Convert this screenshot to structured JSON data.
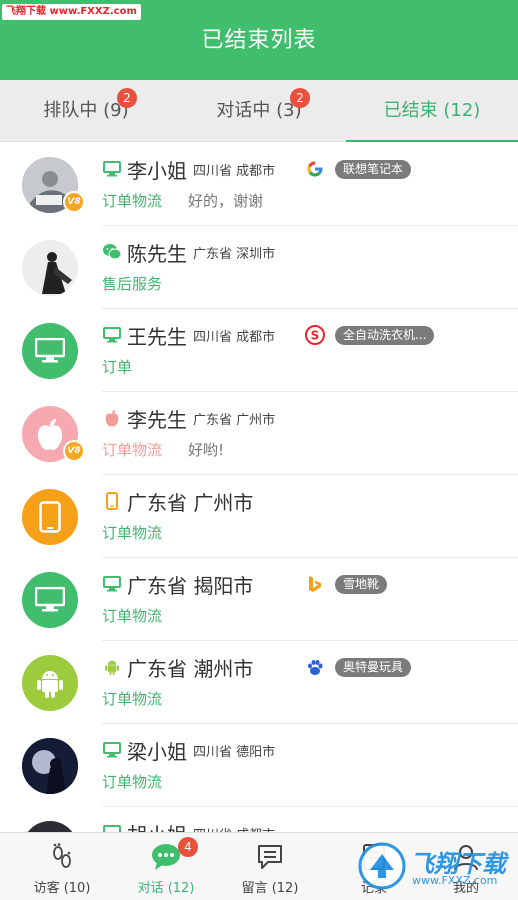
{
  "watermark_top": "飞翔下载 www.FXXZ.com",
  "header": {
    "title": "已结束列表"
  },
  "tabs": [
    {
      "label": "排队中 (9)",
      "badge": "2"
    },
    {
      "label": "对话中 (3)",
      "badge": "2"
    },
    {
      "label": "已结束 (12)"
    }
  ],
  "rows": [
    {
      "name": "李小姐",
      "location": "四川省 成都市",
      "device": "pc-icon",
      "source": "google-icon",
      "keyword": "联想笔记本",
      "category": "订单物流",
      "message": "好的，谢谢",
      "vip": "V8",
      "avatar": "photo"
    },
    {
      "name": "陈先生",
      "location": "广东省 深圳市",
      "device": "wechat-icon",
      "category": "售后服务",
      "avatar": "photo"
    },
    {
      "name": "王先生",
      "location": "四川省 成都市",
      "device": "pc-icon",
      "source": "sogou-icon",
      "keyword": "全自动洗衣机...",
      "category": "订单",
      "avatar": "pc"
    },
    {
      "name": "李先生",
      "location": "广东省 广州市",
      "device": "apple-icon",
      "category": "订单物流",
      "message": "好哟!",
      "vip": "V8",
      "avatar": "apple"
    },
    {
      "name": "广东省 广州市",
      "location": "",
      "device": "phone-icon",
      "category": "订单物流",
      "avatar": "phone"
    },
    {
      "name": "广东省 揭阳市",
      "location": "",
      "device": "pc-icon",
      "source": "bing-icon",
      "keyword": "雪地靴",
      "category": "订单物流",
      "avatar": "pc"
    },
    {
      "name": "广东省 潮州市",
      "location": "",
      "device": "android-icon",
      "source": "baidu-icon",
      "keyword": "奥特曼玩具",
      "category": "订单物流",
      "avatar": "android"
    },
    {
      "name": "梁小姐",
      "location": "四川省 德阳市",
      "device": "pc-icon",
      "category": "订单物流",
      "avatar": "photo"
    },
    {
      "name": "胡小姐",
      "location": "四川省 成都市",
      "device": "pc-icon",
      "category": "",
      "avatar": "photo"
    }
  ],
  "bottom_nav": [
    {
      "label": "访客 (10)",
      "icon": "footprint-icon"
    },
    {
      "label": "对话 (12)",
      "icon": "chat-bubble-icon",
      "badge": "4"
    },
    {
      "label": "留言 (12)",
      "icon": "message-icon"
    },
    {
      "label": "记录",
      "icon": "record-icon"
    },
    {
      "label": "我的",
      "icon": "user-icon"
    }
  ],
  "watermark_bottom": {
    "brand": "飞翔下载",
    "url": "www.FXXZ.com"
  },
  "colors": {
    "primary": "#41bd6e",
    "badge": "#e8513c",
    "vip": "#f5a623"
  }
}
